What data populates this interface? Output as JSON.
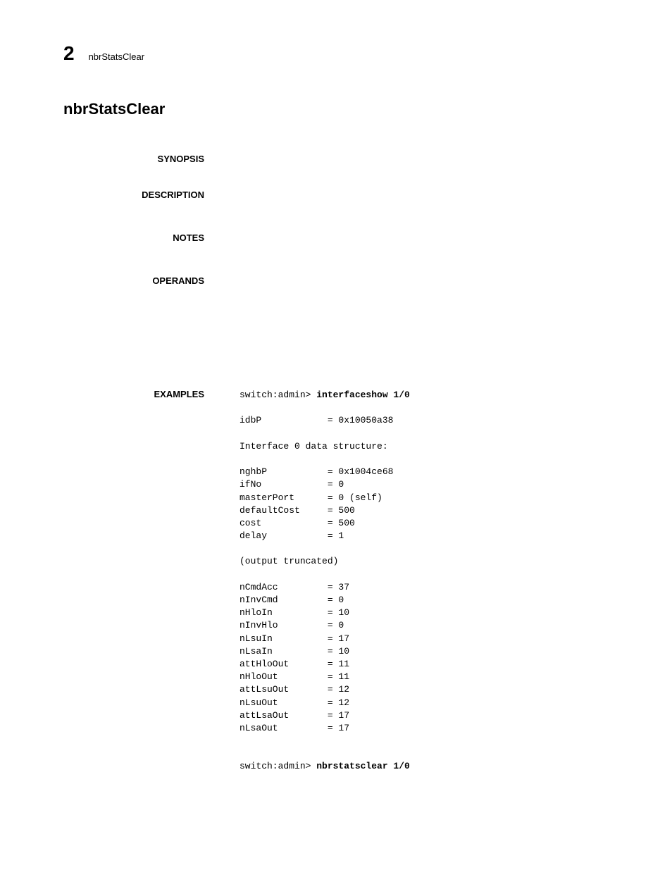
{
  "header": {
    "chapter_num": "2",
    "text": "nbrStatsClear"
  },
  "title": "nbrStatsClear",
  "sections": {
    "synopsis": "SYNOPSIS",
    "description": "DESCRIPTION",
    "notes": "NOTES",
    "operands": "OPERANDS",
    "examples": "EXAMPLES"
  },
  "example": {
    "prompt1": "switch:admin> ",
    "cmd1": "interfaceshow 1/0",
    "line1": "idbP            = 0x10050a38",
    "line2": "Interface 0 data structure:",
    "line3": "nghbP           = 0x1004ce68",
    "line4": "ifNo            = 0",
    "line5": "masterPort      = 0 (self)",
    "line6": "defaultCost     = 500",
    "line7": "cost            = 500",
    "line8": "delay           = 1",
    "line9": "(output truncated)",
    "line10": "nCmdAcc         = 37",
    "line11": "nInvCmd         = 0",
    "line12": "nHloIn          = 10",
    "line13": "nInvHlo         = 0",
    "line14": "nLsuIn          = 17",
    "line15": "nLsaIn          = 10",
    "line16": "attHloOut       = 11",
    "line17": "nHloOut         = 11",
    "line18": "attLsuOut       = 12",
    "line19": "nLsuOut         = 12",
    "line20": "attLsaOut       = 17",
    "line21": "nLsaOut         = 17",
    "prompt2": "switch:admin> ",
    "cmd2": "nbrstatsclear 1/0"
  }
}
